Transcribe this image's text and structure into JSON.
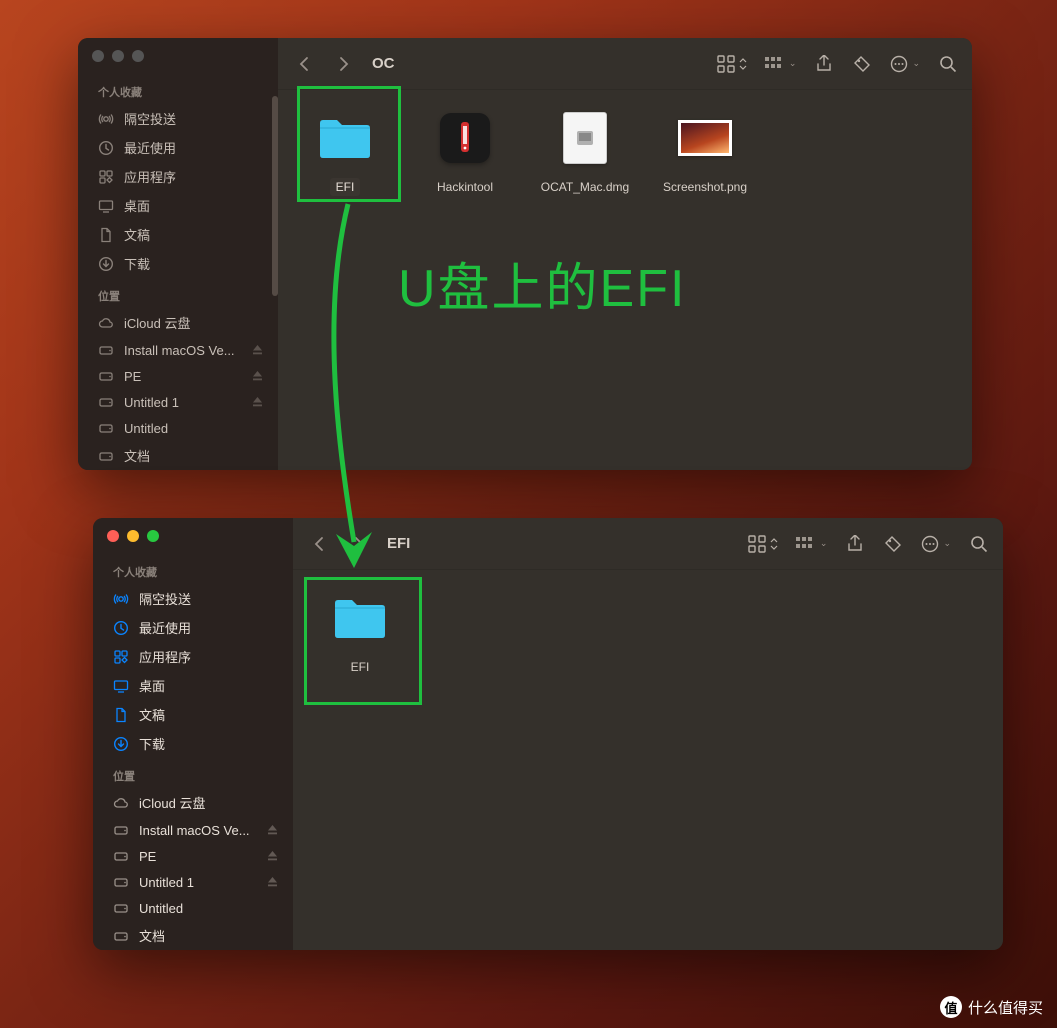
{
  "annotation": "U盘上的EFI",
  "watermark": "什么值得买",
  "watermark_badge": "值",
  "window1": {
    "title": "OC",
    "sidebar": {
      "favorites_heading": "个人收藏",
      "locations_heading": "位置",
      "favorites": [
        {
          "icon": "airdrop",
          "label": "隔空投送"
        },
        {
          "icon": "clock",
          "label": "最近使用"
        },
        {
          "icon": "apps",
          "label": "应用程序"
        },
        {
          "icon": "desktop",
          "label": "桌面"
        },
        {
          "icon": "doc",
          "label": "文稿"
        },
        {
          "icon": "download",
          "label": "下载"
        }
      ],
      "locations": [
        {
          "icon": "cloud",
          "label": "iCloud 云盘",
          "eject": false
        },
        {
          "icon": "disk",
          "label": "Install macOS Ve...",
          "eject": true
        },
        {
          "icon": "disk",
          "label": "PE",
          "eject": true
        },
        {
          "icon": "disk",
          "label": "Untitled 1",
          "eject": true
        },
        {
          "icon": "disk",
          "label": "Untitled",
          "eject": false
        },
        {
          "icon": "disk",
          "label": "文档",
          "eject": false
        }
      ]
    },
    "files": [
      {
        "type": "folder",
        "label": "EFI",
        "selected": true
      },
      {
        "type": "app",
        "label": "Hackintool"
      },
      {
        "type": "dmg",
        "label": "OCAT_Mac.dmg"
      },
      {
        "type": "png",
        "label": "Screenshot.png"
      }
    ]
  },
  "window2": {
    "title": "EFI",
    "sidebar": {
      "favorites_heading": "个人收藏",
      "locations_heading": "位置",
      "favorites": [
        {
          "icon": "airdrop",
          "label": "隔空投送"
        },
        {
          "icon": "clock",
          "label": "最近使用"
        },
        {
          "icon": "apps",
          "label": "应用程序"
        },
        {
          "icon": "desktop",
          "label": "桌面"
        },
        {
          "icon": "doc",
          "label": "文稿"
        },
        {
          "icon": "download",
          "label": "下载"
        }
      ],
      "locations": [
        {
          "icon": "cloud",
          "label": "iCloud 云盘",
          "eject": false
        },
        {
          "icon": "disk",
          "label": "Install macOS Ve...",
          "eject": true
        },
        {
          "icon": "disk",
          "label": "PE",
          "eject": true
        },
        {
          "icon": "disk",
          "label": "Untitled 1",
          "eject": true
        },
        {
          "icon": "disk",
          "label": "Untitled",
          "eject": false
        },
        {
          "icon": "disk",
          "label": "文档",
          "eject": false
        }
      ]
    },
    "files": [
      {
        "type": "folder",
        "label": "EFI",
        "selected": false
      }
    ]
  },
  "sidebar_icon_colors": {
    "w1": "#8a817a",
    "airdrop": "#0a84ff",
    "clock": "#0a84ff",
    "apps": "#0a84ff",
    "desktop": "#0a84ff",
    "doc": "#0a84ff",
    "download": "#0a84ff"
  }
}
